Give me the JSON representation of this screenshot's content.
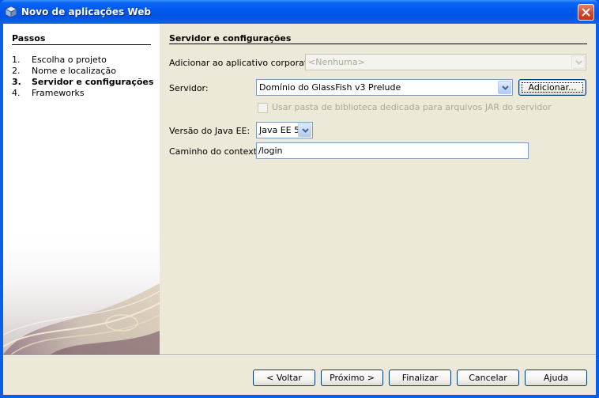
{
  "window": {
    "title": "Novo de aplicações Web"
  },
  "steps": {
    "title": "Passos",
    "items": [
      {
        "num": "1.",
        "label": "Escolha o projeto",
        "current": false
      },
      {
        "num": "2.",
        "label": "Nome e localização",
        "current": false
      },
      {
        "num": "3.",
        "label": "Servidor e configurações",
        "current": true
      },
      {
        "num": "4.",
        "label": "Frameworks",
        "current": false
      }
    ]
  },
  "panel": {
    "title": "Servidor e configurações",
    "enterprise_label": "Adicionar ao aplicativo corporativo:",
    "enterprise_value": "<Nenhuma>",
    "server_label": "Servidor:",
    "server_value": "Domínio do GlassFish v3 Prelude",
    "add_button": "Adicionar...",
    "dedicated_lib_label": "Usar pasta de biblioteca dedicada para arquivos JAR do servidor",
    "javaee_label": "Versão do Java EE:",
    "javaee_value": "Java EE 5",
    "context_label": "Caminho do contexto:",
    "context_value": "/login"
  },
  "buttons": {
    "back": "< Voltar",
    "next": "Próximo >",
    "finish": "Finalizar",
    "cancel": "Cancelar",
    "help": "Ajuda"
  },
  "colors": {
    "titlebar": "#0054e3",
    "dialog_bg": "#ece9d8",
    "close_button": "#d4492a"
  }
}
